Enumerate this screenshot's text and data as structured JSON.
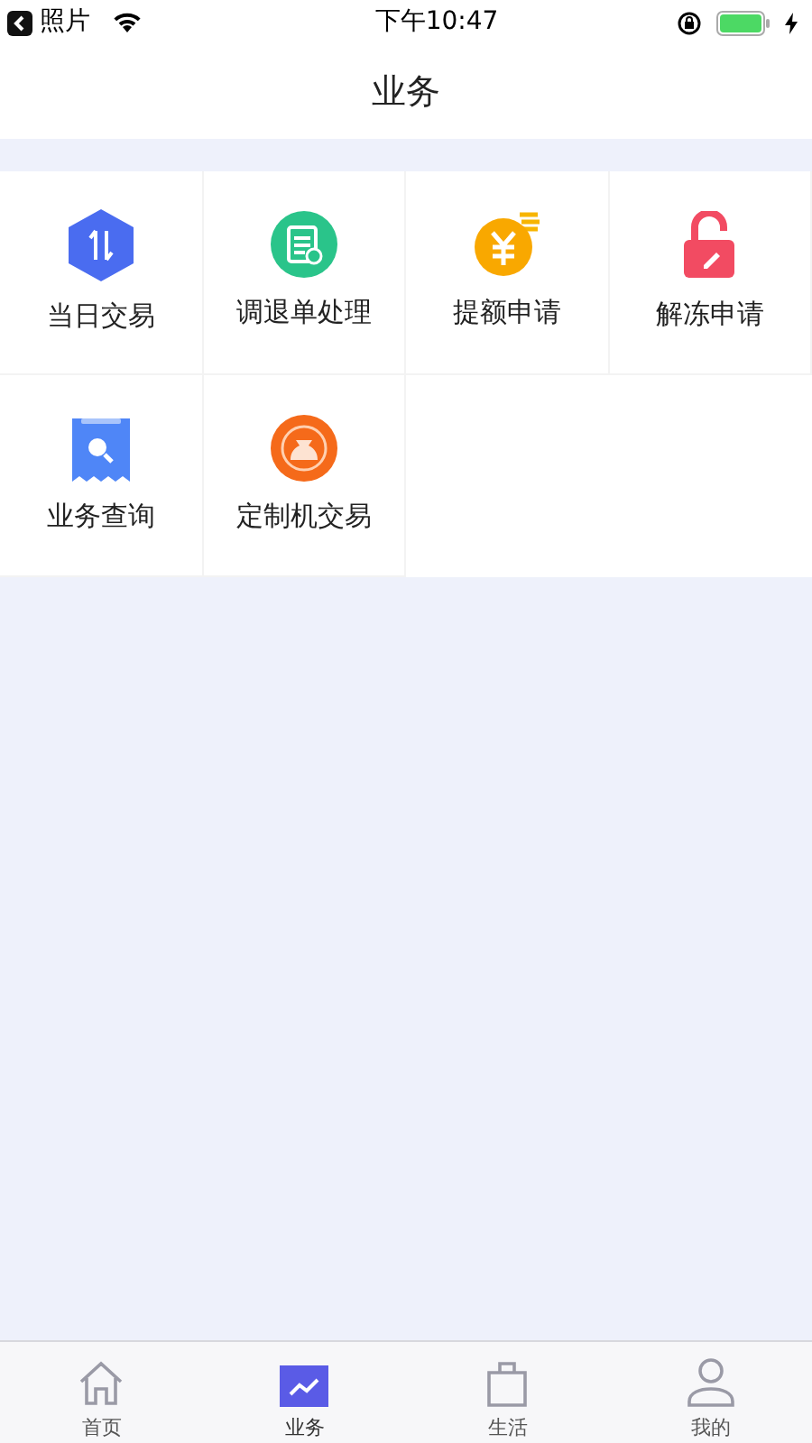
{
  "status_bar": {
    "back_label": "照片",
    "time": "下午10:47"
  },
  "header": {
    "title": "业务"
  },
  "services": [
    {
      "label": "当日交易"
    },
    {
      "label": "调退单处理"
    },
    {
      "label": "提额申请"
    },
    {
      "label": "解冻申请"
    },
    {
      "label": "业务查询"
    },
    {
      "label": "定制机交易"
    }
  ],
  "tab_bar": [
    {
      "label": "首页",
      "selected": false
    },
    {
      "label": "业务",
      "selected": true
    },
    {
      "label": "生活",
      "selected": false
    },
    {
      "label": "我的",
      "selected": false
    }
  ]
}
